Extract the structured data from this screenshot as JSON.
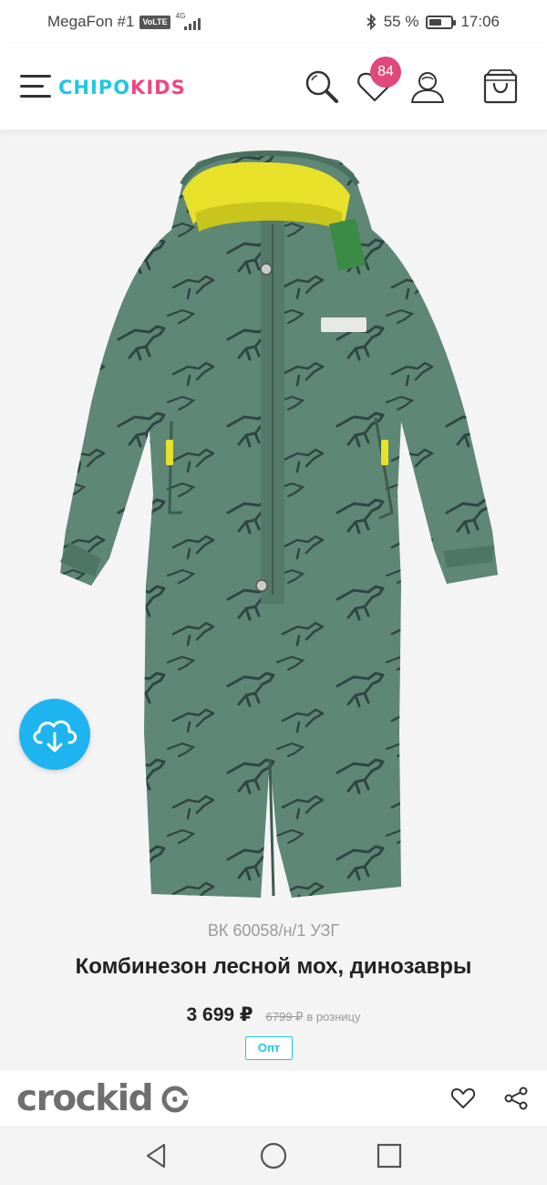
{
  "status_bar": {
    "carrier": "MegaFon #1",
    "volte": "VoLTE",
    "network": "4G",
    "battery": "55 %",
    "battery_level": 0.55,
    "time": "17:06"
  },
  "header": {
    "menu_icon": "hamburger-icon",
    "logo_part1": "CHIPO",
    "logo_part2": "KIDS",
    "favorites_count": "84",
    "icons": [
      "search-icon",
      "heart-icon",
      "user-icon",
      "bag-icon"
    ]
  },
  "product": {
    "image_icon": "download-cloud-icon",
    "sku": "ВК 60058/н/1 УЗГ",
    "title": "Комбинезон лесной мох, динозавры",
    "price": "3 699 ₽",
    "old_price": "6799 ₽",
    "old_price_label": "в розницу",
    "wholesale_badge": "Опт"
  },
  "footer": {
    "brand": "crockid",
    "icons": [
      "heart-outline-icon",
      "share-icon"
    ]
  },
  "navbar": {
    "icons": [
      "back-triangle-icon",
      "home-circle-icon",
      "recents-square-icon"
    ]
  },
  "colors": {
    "accent_cyan": "#20c7e3",
    "accent_pink": "#f0467e",
    "badge_pink": "#e0497a",
    "fab_blue": "#1eb4f0",
    "suit_green": "#5f8775",
    "lining_yellow": "#e7e12a"
  }
}
